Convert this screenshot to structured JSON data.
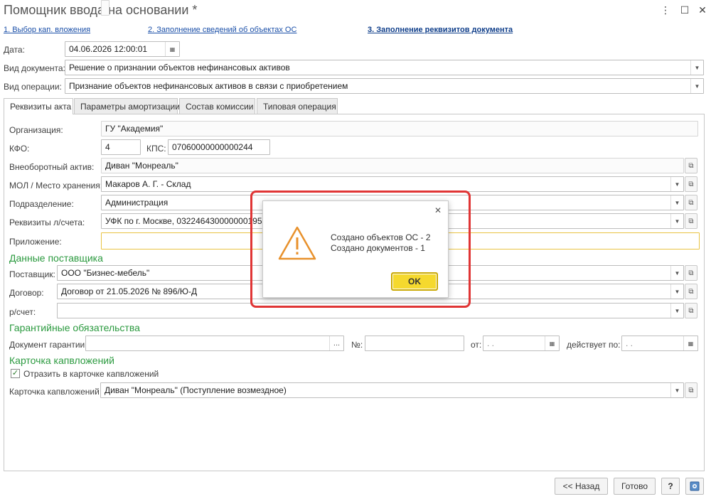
{
  "window": {
    "title": "Помощник ввода на основании *",
    "controls": [
      "⋮",
      "☐",
      "✕"
    ]
  },
  "steps": [
    {
      "label": "1. Выбор кап. вложения"
    },
    {
      "label": "2. Заполнение сведений об объектах ОС"
    },
    {
      "label": "3. Заполнение реквизитов документа"
    }
  ],
  "header": {
    "date_label": "Дата:",
    "date_value": "04.06.2026 12:00:01",
    "doc_type_label": "Вид документа:",
    "doc_type_value": "Решение о признании объектов нефинансовых активов",
    "operation_label": "Вид операции:",
    "operation_value": "Признание объектов нефинансовых активов в связи с приобретением"
  },
  "tabs": [
    {
      "label": "Реквизиты акта"
    },
    {
      "label": "Параметры амортизации"
    },
    {
      "label": "Состав комиссии"
    },
    {
      "label": "Типовая операция"
    }
  ],
  "form": {
    "org_label": "Организация:",
    "org_value": "ГУ \"Академия\"",
    "kfo_label": "КФО:",
    "kfo_value": "4",
    "kps_label": "КПС:",
    "kps_value": "07060000000000244",
    "asset_label": "Внеоборотный актив:",
    "asset_value": "Диван \"Монреаль\"",
    "mol_label": "МОЛ / Место хранения:",
    "mol_value": "Макаров А. Г. - Склад",
    "dept_label": "Подразделение:",
    "dept_value": "Администрация",
    "account_label": "Реквизиты л/счета:",
    "account_value": "УФК по г. Москве, 0322464300000001950",
    "attachment_label": "Приложение:",
    "attachment_value": ""
  },
  "supplier": {
    "section_title": "Данные поставщика",
    "supplier_label": "Поставщик:",
    "supplier_value": "ООО \"Бизнес-мебель\"",
    "contract_label": "Договор:",
    "contract_value": "Договор от 21.05.2026 № 896/Ю-Д",
    "account_label": "р/счет:",
    "account_value": ""
  },
  "guarantee": {
    "section_title": "Гарантийные обязательства",
    "doc_label": "Документ гарантии:",
    "doc_value": "",
    "doc_btn": "...",
    "num_label": "№:",
    "num_value": "",
    "from_label": "от:",
    "from_value": " .  .",
    "valid_label": "действует по:",
    "valid_value": " .  ."
  },
  "card": {
    "section_title": "Карточка капвложений",
    "reflect_label": "Отразить в карточке капвложений",
    "reflect_checked": "✓",
    "card_label": "Карточка капвложений:",
    "card_value": "Диван \"Монреаль\" (Поступление возмездное)"
  },
  "footer": {
    "back_label": "<< Назад",
    "done_label": "Готово",
    "help_label": "?"
  },
  "dialog": {
    "line1": "Создано объектов ОС - 2",
    "line2": "Создано документов - 1",
    "ok_label": "OK",
    "close": "✕"
  },
  "colors": {
    "section": "#2b9a3f",
    "link": "#1a4fa8",
    "ok_button": "#f5d92e",
    "highlight": "#e03535",
    "warning": "#e8912c"
  }
}
